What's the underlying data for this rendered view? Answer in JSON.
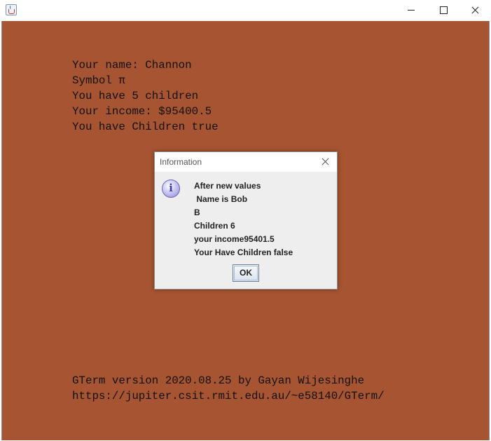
{
  "window": {
    "icon": "java-cup-icon",
    "controls": {
      "minimize": "minimize-icon",
      "maximize": "maximize-icon",
      "close": "close-icon"
    }
  },
  "terminal": {
    "background": "#a65431",
    "lines": [
      "Your name: Channon",
      "Symbol π",
      "You have 5 children",
      "Your income: $95400.5",
      "You have Children true"
    ],
    "footer": [
      "GTerm version 2020.08.25 by Gayan Wijesinghe",
      "https://jupiter.csit.rmit.edu.au/~e58140/GTerm/"
    ]
  },
  "dialog": {
    "title": "Information",
    "icon": "information-icon",
    "messages": [
      "After new values",
      " Name is Bob",
      "B",
      "Children 6",
      "your income95401.5",
      "Your Have Children false"
    ],
    "ok_label": "OK"
  }
}
